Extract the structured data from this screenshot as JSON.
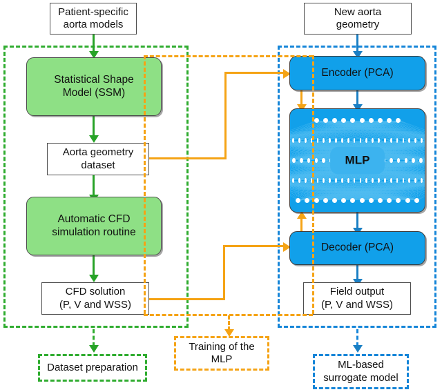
{
  "colors": {
    "green_fill": "#8ee085",
    "blue_fill": "#11a0ea",
    "green_accent": "#2fac2f",
    "orange_accent": "#f5a315",
    "blue_accent": "#1585d8",
    "box_border": "#4d4d4d"
  },
  "boxes": {
    "patient_models": "Patient-specific\naorta models",
    "ssm": "Statistical Shape\nModel (SSM)",
    "aorta_dataset": "Aorta geometry\ndataset",
    "cfd_routine": "Automatic CFD\nsimulation routine",
    "cfd_solution": "CFD solution\n(P, V and WSS)",
    "new_geometry": "New aorta\ngeometry",
    "encoder": "Encoder (PCA)",
    "mlp": "MLP",
    "decoder": "Decoder (PCA)",
    "field_output": "Field output\n(P, V and WSS)"
  },
  "legends": {
    "dataset_preparation": "Dataset preparation",
    "training_mlp": "Training of the\nMLP",
    "surrogate_model": "ML-based\nsurrogate model"
  },
  "mlp_network": {
    "layers": [
      {
        "nodes": 10
      },
      {
        "nodes": 22
      },
      {
        "nodes": 18
      },
      {
        "nodes": 22
      },
      {
        "nodes": 14
      }
    ]
  }
}
